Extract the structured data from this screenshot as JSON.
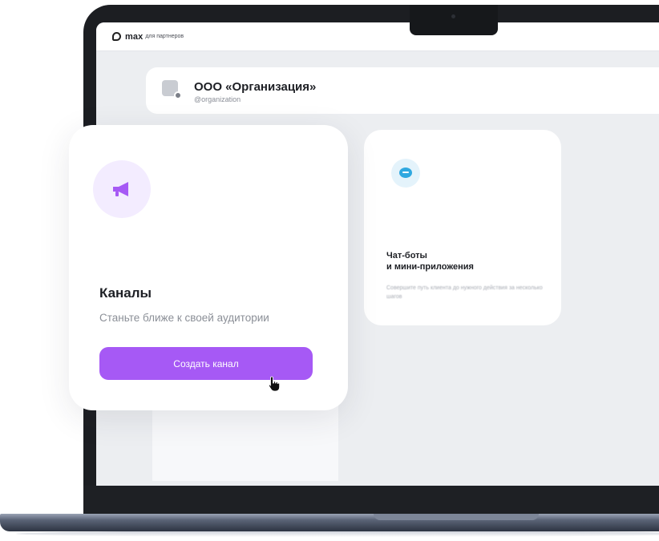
{
  "topbar": {
    "logo": "max",
    "logo_sub": "для партнеров"
  },
  "organization": {
    "name": "ООО «Организация»",
    "handle": "@organization"
  },
  "channels_card": {
    "title": "Каналы",
    "subtitle": "Станьте ближе к своей аудитории",
    "button_label": "Создать канал",
    "icon": "megaphone-icon",
    "accent_color": "#a659f5"
  },
  "bots_card": {
    "title_line1": "Чат-боты",
    "title_line2": "и мини-приложения",
    "description": "Совершите путь клиента до нужного действия за несколько шагов",
    "icon": "chat-bubble-icon",
    "accent_color": "#2fa8e0"
  }
}
